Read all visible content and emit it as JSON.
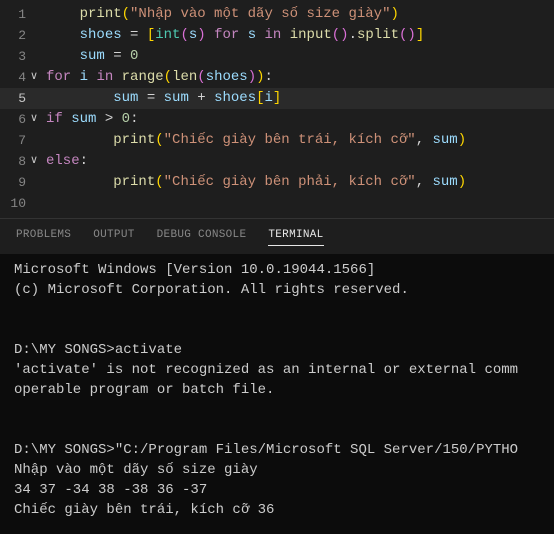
{
  "editor": {
    "lines": [
      {
        "n": "1",
        "chev": "",
        "active": false,
        "tokens": [
          [
            "    ",
            ""
          ],
          [
            "print",
            "fn"
          ],
          [
            "(",
            "par"
          ],
          [
            "\"Nhập vào một dãy số size giày\"",
            "str"
          ],
          [
            ")",
            "par"
          ]
        ]
      },
      {
        "n": "2",
        "chev": "",
        "active": false,
        "tokens": [
          [
            "    ",
            ""
          ],
          [
            "shoes",
            "var"
          ],
          [
            " = ",
            "op"
          ],
          [
            "[",
            "par"
          ],
          [
            "int",
            "type"
          ],
          [
            "(",
            "par2"
          ],
          [
            "s",
            "var"
          ],
          [
            ")",
            "par2"
          ],
          [
            " ",
            ""
          ],
          [
            "for",
            "kw"
          ],
          [
            " ",
            ""
          ],
          [
            "s",
            "var"
          ],
          [
            " ",
            ""
          ],
          [
            "in",
            "kw"
          ],
          [
            " ",
            ""
          ],
          [
            "input",
            "fn"
          ],
          [
            "(",
            "par2"
          ],
          [
            ")",
            "par2"
          ],
          [
            ".",
            "op"
          ],
          [
            "split",
            "fn"
          ],
          [
            "(",
            "par2"
          ],
          [
            ")",
            "par2"
          ],
          [
            "]",
            "par"
          ]
        ]
      },
      {
        "n": "3",
        "chev": "",
        "active": false,
        "tokens": [
          [
            "    ",
            ""
          ],
          [
            "sum",
            "var"
          ],
          [
            " = ",
            "op"
          ],
          [
            "0",
            "num"
          ]
        ]
      },
      {
        "n": "4",
        "chev": "∨",
        "active": false,
        "tokens": [
          [
            "for",
            "kw"
          ],
          [
            " ",
            ""
          ],
          [
            "i",
            "var"
          ],
          [
            " ",
            ""
          ],
          [
            "in",
            "kw"
          ],
          [
            " ",
            ""
          ],
          [
            "range",
            "fn"
          ],
          [
            "(",
            "par"
          ],
          [
            "len",
            "fn"
          ],
          [
            "(",
            "par2"
          ],
          [
            "shoes",
            "var"
          ],
          [
            ")",
            "par2"
          ],
          [
            ")",
            "par"
          ],
          [
            ":",
            ""
          ]
        ]
      },
      {
        "n": "5",
        "chev": "",
        "active": true,
        "tokens": [
          [
            "        ",
            ""
          ],
          [
            "sum",
            "var"
          ],
          [
            " = ",
            "op"
          ],
          [
            "sum",
            "var"
          ],
          [
            " + ",
            "op"
          ],
          [
            "shoes",
            "var"
          ],
          [
            "[",
            "par"
          ],
          [
            "i",
            "var"
          ],
          [
            "]",
            "par"
          ]
        ]
      },
      {
        "n": "6",
        "chev": "∨",
        "active": false,
        "tokens": [
          [
            "if",
            "kw"
          ],
          [
            " ",
            ""
          ],
          [
            "sum",
            "var"
          ],
          [
            " > ",
            "op"
          ],
          [
            "0",
            "num"
          ],
          [
            ":",
            ""
          ]
        ]
      },
      {
        "n": "7",
        "chev": "",
        "active": false,
        "tokens": [
          [
            "        ",
            ""
          ],
          [
            "print",
            "fn"
          ],
          [
            "(",
            "par"
          ],
          [
            "\"Chiếc giày bên trái, kích cỡ\"",
            "str"
          ],
          [
            ", ",
            "op"
          ],
          [
            "sum",
            "var"
          ],
          [
            ")",
            "par"
          ]
        ]
      },
      {
        "n": "8",
        "chev": "∨",
        "active": false,
        "tokens": [
          [
            "else",
            "kw"
          ],
          [
            ":",
            ""
          ]
        ]
      },
      {
        "n": "9",
        "chev": "",
        "active": false,
        "tokens": [
          [
            "        ",
            ""
          ],
          [
            "print",
            "fn"
          ],
          [
            "(",
            "par"
          ],
          [
            "\"Chiếc giày bên phải, kích cỡ\"",
            "str"
          ],
          [
            ", ",
            "op"
          ],
          [
            "sum",
            "var"
          ],
          [
            ")",
            "par"
          ]
        ]
      },
      {
        "n": "10",
        "chev": "",
        "active": false,
        "tokens": []
      }
    ]
  },
  "panel": {
    "tabs": [
      "PROBLEMS",
      "OUTPUT",
      "DEBUG CONSOLE",
      "TERMINAL"
    ],
    "activeTab": 3
  },
  "terminal": {
    "lines": [
      "Microsoft Windows [Version 10.0.19044.1566]",
      "(c) Microsoft Corporation. All rights reserved.",
      "",
      "",
      "D:\\MY SONGS>activate",
      "'activate' is not recognized as an internal or external comm",
      "operable program or batch file.",
      "",
      "",
      "D:\\MY SONGS>\"C:/Program Files/Microsoft SQL Server/150/PYTHO",
      "Nhập vào một dãy số size giày",
      "34 37 -34 38 -38 36 -37",
      "Chiếc giày bên trái, kích cỡ 36"
    ]
  }
}
